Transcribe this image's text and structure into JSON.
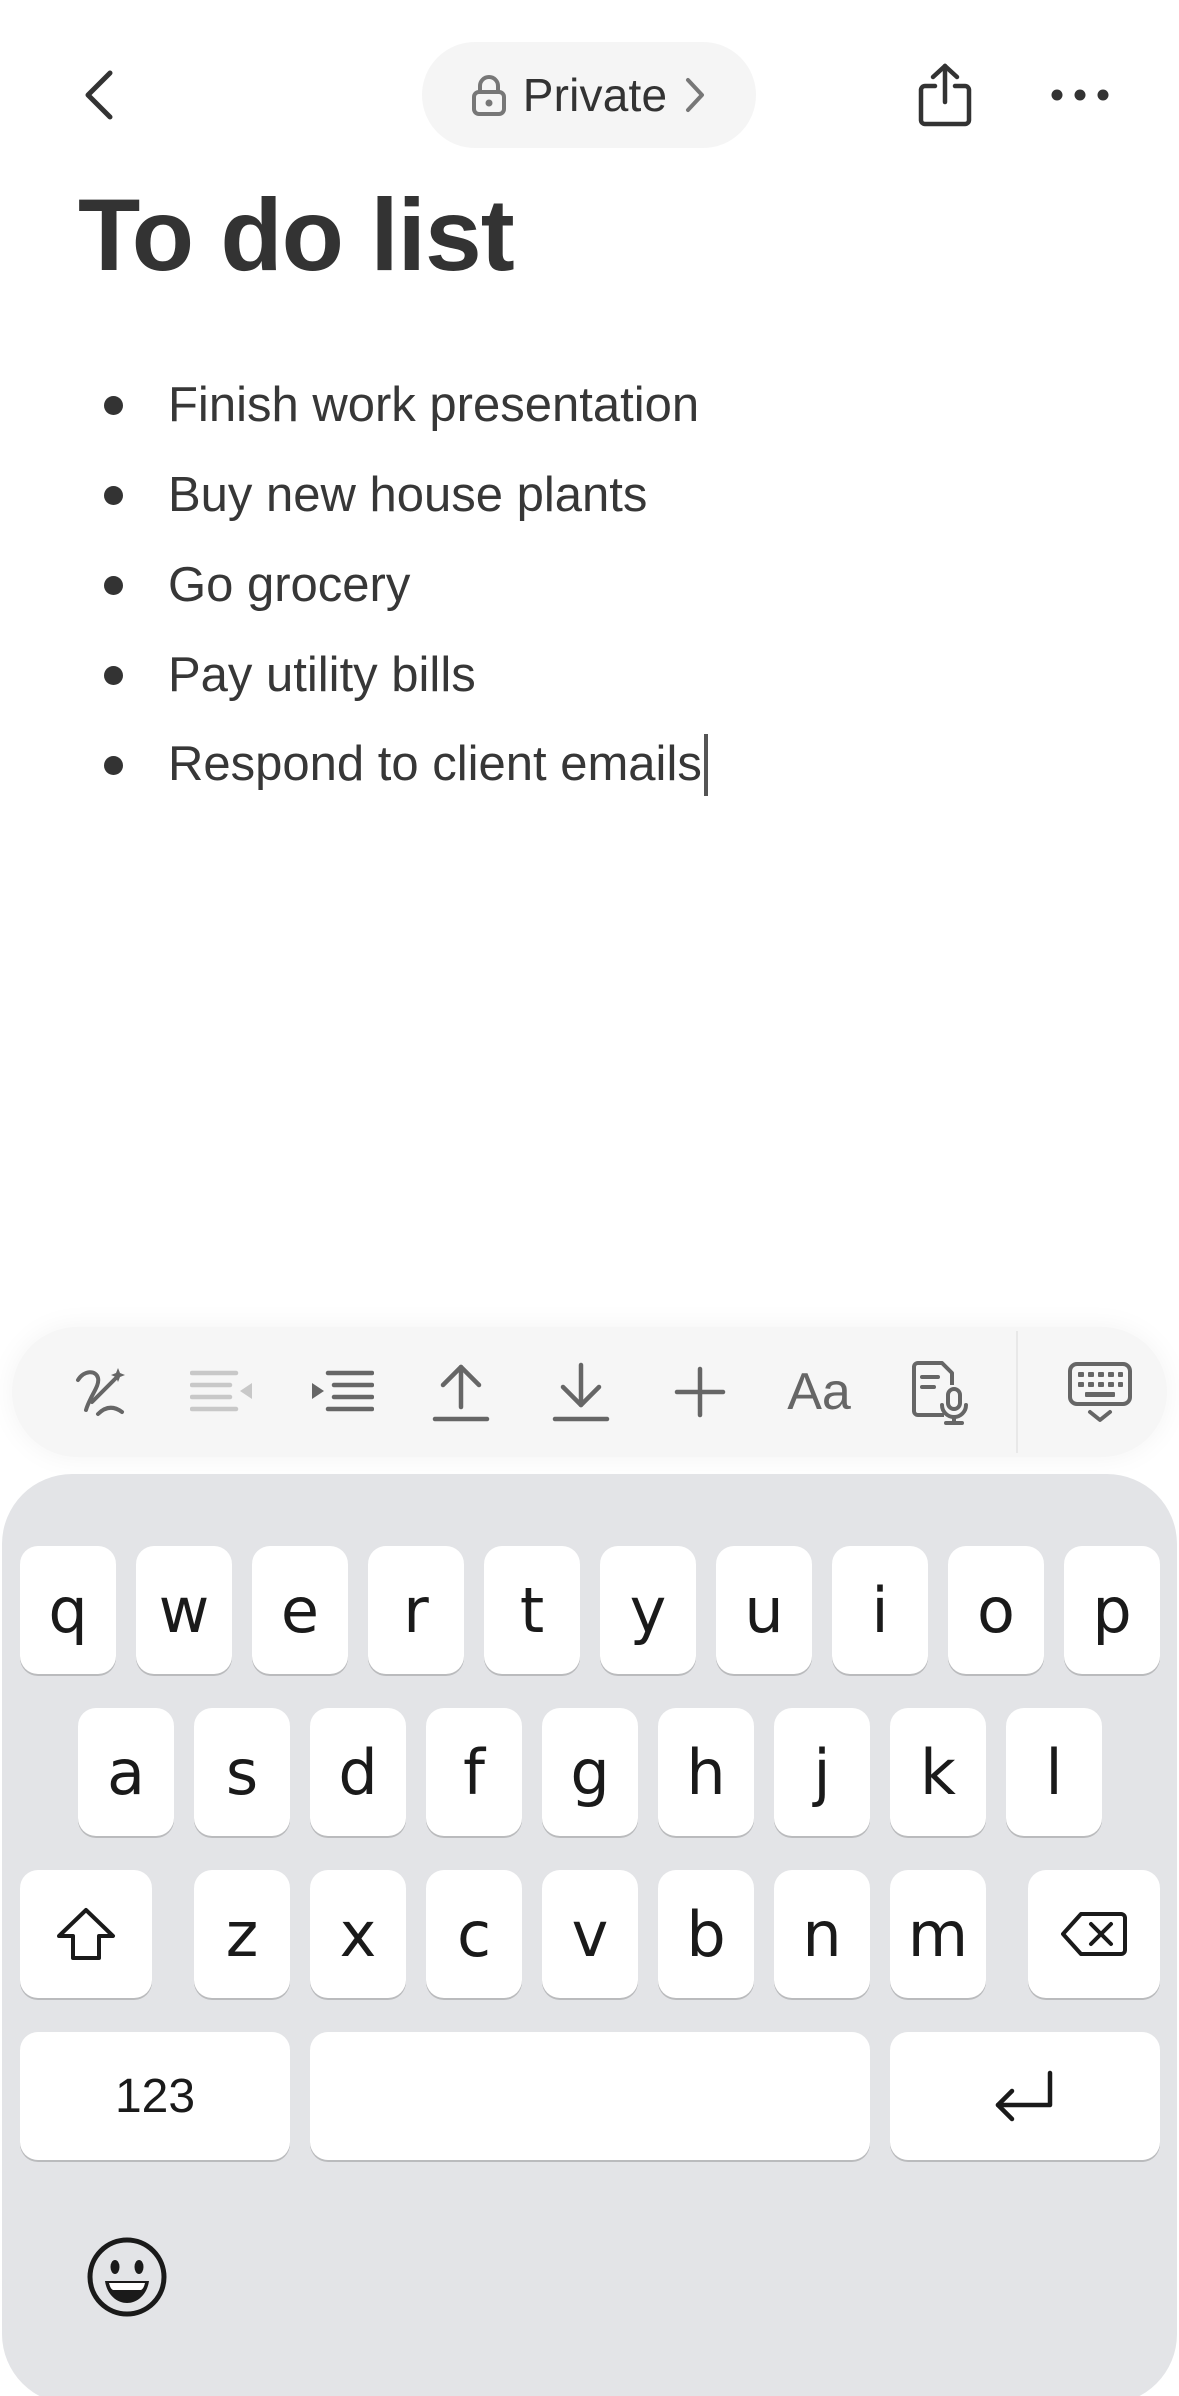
{
  "header": {
    "privacy_label": "Private",
    "icons": {
      "back": "chevron-left-icon",
      "lock": "lock-icon",
      "forward": "chevron-right-icon",
      "share": "share-icon",
      "more": "ellipsis-icon"
    }
  },
  "document": {
    "title": "To do list",
    "items": [
      "Finish work presentation",
      "Buy new house plants",
      "Go grocery",
      "Pay utility bills",
      "Respond to client emails"
    ]
  },
  "toolbar": {
    "icons": [
      "ai-write-icon",
      "outdent-icon",
      "indent-icon",
      "move-up-icon",
      "move-down-icon",
      "insert-plus-icon",
      "text-format-icon",
      "voice-note-icon",
      "hide-keyboard-icon"
    ],
    "text_format_label": "Aa"
  },
  "keyboard": {
    "rows": [
      [
        "q",
        "w",
        "e",
        "r",
        "t",
        "y",
        "u",
        "i",
        "o",
        "p"
      ],
      [
        "a",
        "s",
        "d",
        "f",
        "g",
        "h",
        "j",
        "k",
        "l"
      ],
      [
        "z",
        "x",
        "c",
        "v",
        "b",
        "n",
        "m"
      ]
    ],
    "numbers_label": "123",
    "icons": {
      "shift": "shift-icon",
      "backspace": "backspace-icon",
      "return": "return-icon",
      "emoji": "emoji-icon"
    }
  },
  "colors": {
    "text": "#333333",
    "pill_background": "#f5f5f5",
    "toolbar_background": "#f6f6f6",
    "keyboard_background": "#e3e4e7",
    "key_background": "#ffffff",
    "disabled_icon": "#c8c8c8"
  }
}
